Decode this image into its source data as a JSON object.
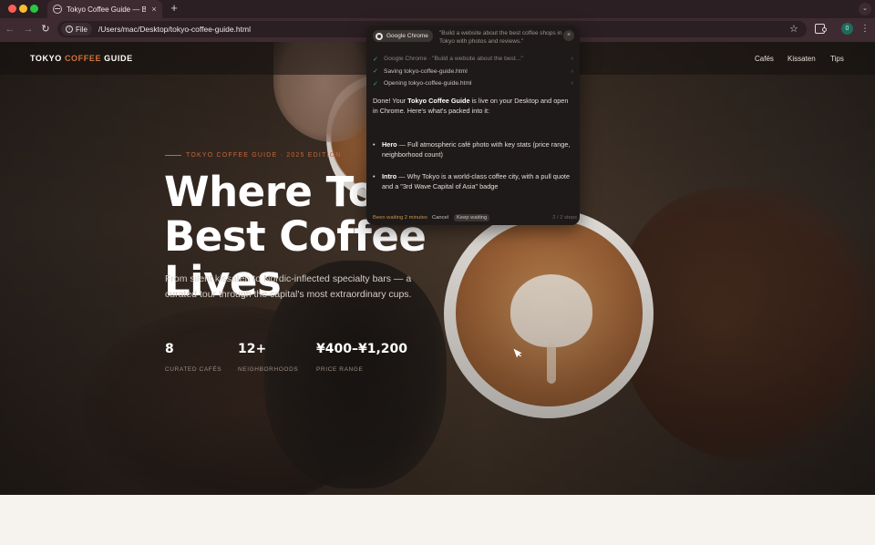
{
  "browser": {
    "tab_title": "Tokyo Coffee Guide — Best C",
    "tab_close": "×",
    "new_tab": "+",
    "tab_menu": "⌄",
    "file_chip": "File",
    "url": "/Users/mac/Desktop/tokyo-coffee-guide.html",
    "profile_initial": "0",
    "icons": [
      "back-icon",
      "forward-icon",
      "reload-icon",
      "info-icon",
      "star-icon",
      "extensions-icon",
      "kebab-menu-icon"
    ]
  },
  "site": {
    "logo_part1": "TOKYO ",
    "logo_part2": "COFFEE",
    "logo_part3": " GUIDE",
    "accent_color": "#d4733c",
    "nav": [
      "Cafés",
      "Kissaten",
      "Tips"
    ]
  },
  "hero": {
    "eyebrow": "TOKYO COFFEE GUIDE · 2025 EDITION",
    "headline_line1": "Where Toky",
    "headline_line2": "Best Coffee Lives",
    "subtitle": "From silent kissaten to Nordic-inflected specialty bars — a curated tour through the capital's most extraordinary cups.",
    "stats": [
      {
        "value": "8",
        "label": "CURATED CAFÉS"
      },
      {
        "value": "12+",
        "label": "NEIGHBORHOODS"
      },
      {
        "value": "¥400–¥1,200",
        "label": "PRICE RANGE"
      }
    ]
  },
  "agent": {
    "source": "Google Chrome",
    "prompt": "\"Build a website about the best coffee shops in Tokyo with photos and reviews.\"",
    "close": "×",
    "steps": [
      {
        "text": "Google Chrome · \"Build a website about the best...\"",
        "muted": true
      },
      {
        "text": "Saving tokyo-coffee-guide.html",
        "muted": false
      },
      {
        "text": "Opening tokyo-coffee-guide.html",
        "muted": false
      }
    ],
    "message_pre": "Done! Your ",
    "message_bold": "Tokyo Coffee Guide",
    "message_post": " is live on your Desktop and open in Chrome. Here's what's packed into it:",
    "bullets": [
      {
        "title": "Hero",
        "text": " — Full atmospheric café photo with key stats (price range, neighborhood count)"
      },
      {
        "title": "Intro",
        "text": " — Why Tokyo is a world-class coffee city, with a pull quote and a \"3rd Wave Capital of Asia\" badge"
      }
    ],
    "waiting": "Been waiting 2 minutes",
    "cancel": "Cancel",
    "keep_waiting": "Keep waiting",
    "step_count": "2 / 2 steps",
    "status_color": "#3fae72"
  }
}
